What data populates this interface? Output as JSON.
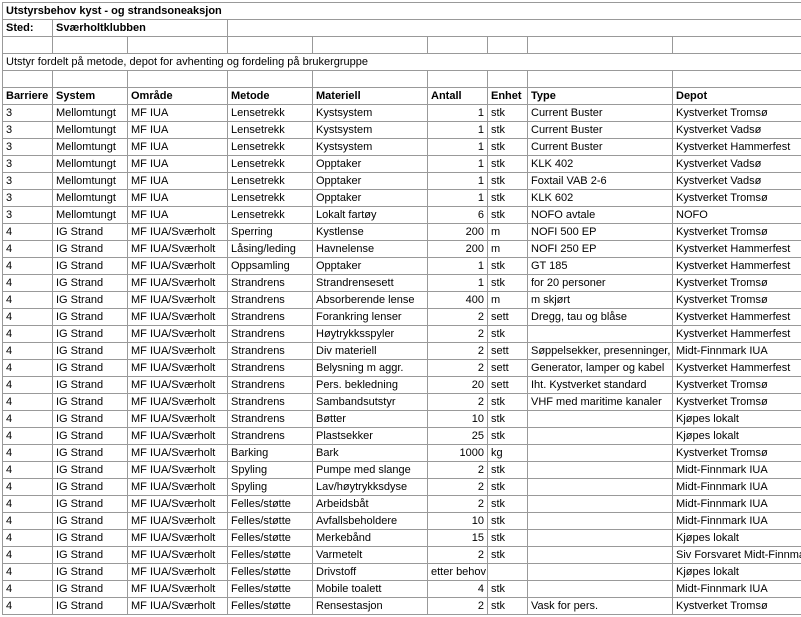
{
  "title": "Utstyrsbehov kyst - og strandsoneaksjon",
  "sted_label": "Sted:",
  "sted_value": "Sværholtklubben",
  "subtitle": "Utstyr fordelt på metode, depot for avhenting og fordeling på brukergruppe",
  "headers": {
    "barriere": "Barriere",
    "system": "System",
    "omrade": "Område",
    "metode": "Metode",
    "materiell": "Materiell",
    "antall": "Antall",
    "enhet": "Enhet",
    "type": "Type",
    "depot": "Depot"
  },
  "rows": [
    {
      "barriere": "3",
      "system": "Mellomtungt",
      "omrade": "MF IUA",
      "metode": "Lensetrekk",
      "materiell": "Kystsystem",
      "antall": "1",
      "enhet": "stk",
      "type": "Current Buster",
      "depot": "Kystverket Tromsø"
    },
    {
      "barriere": "3",
      "system": "Mellomtungt",
      "omrade": "MF IUA",
      "metode": "Lensetrekk",
      "materiell": "Kystsystem",
      "antall": "1",
      "enhet": "stk",
      "type": "Current Buster",
      "depot": "Kystverket Vadsø"
    },
    {
      "barriere": "3",
      "system": "Mellomtungt",
      "omrade": "MF IUA",
      "metode": "Lensetrekk",
      "materiell": "Kystsystem",
      "antall": "1",
      "enhet": "stk",
      "type": "Current Buster",
      "depot": "Kystverket Hammerfest"
    },
    {
      "barriere": "3",
      "system": "Mellomtungt",
      "omrade": "MF IUA",
      "metode": "Lensetrekk",
      "materiell": "Opptaker",
      "antall": "1",
      "enhet": "stk",
      "type": "KLK 402",
      "depot": "Kystverket Vadsø"
    },
    {
      "barriere": "3",
      "system": "Mellomtungt",
      "omrade": "MF IUA",
      "metode": "Lensetrekk",
      "materiell": "Opptaker",
      "antall": "1",
      "enhet": "stk",
      "type": "Foxtail VAB 2-6",
      "depot": "Kystverket Vadsø"
    },
    {
      "barriere": "3",
      "system": "Mellomtungt",
      "omrade": "MF IUA",
      "metode": "Lensetrekk",
      "materiell": "Opptaker",
      "antall": "1",
      "enhet": "stk",
      "type": "KLK 602",
      "depot": "Kystverket Tromsø"
    },
    {
      "barriere": "3",
      "system": "Mellomtungt",
      "omrade": "MF IUA",
      "metode": "Lensetrekk",
      "materiell": "Lokalt fartøy",
      "antall": "6",
      "enhet": "stk",
      "type": "NOFO avtale",
      "depot": "NOFO"
    },
    {
      "barriere": "4",
      "system": "IG Strand",
      "omrade": "MF IUA/Sværholt",
      "metode": "Sperring",
      "materiell": "Kystlense",
      "antall": "200",
      "enhet": "m",
      "type": "NOFI 500 EP",
      "depot": "Kystverket Tromsø"
    },
    {
      "barriere": "4",
      "system": "IG Strand",
      "omrade": "MF IUA/Sværholt",
      "metode": "Låsing/leding",
      "materiell": "Havnelense",
      "antall": "200",
      "enhet": "m",
      "type": "NOFI 250 EP",
      "depot": "Kystverket Hammerfest"
    },
    {
      "barriere": "4",
      "system": "IG Strand",
      "omrade": "MF IUA/Sværholt",
      "metode": "Oppsamling",
      "materiell": "Opptaker",
      "antall": "1",
      "enhet": "stk",
      "type": "GT 185",
      "depot": "Kystverket Hammerfest"
    },
    {
      "barriere": "4",
      "system": "IG Strand",
      "omrade": "MF IUA/Sværholt",
      "metode": "Strandrens",
      "materiell": "Strandrensesett",
      "antall": "1",
      "enhet": "stk",
      "type": "for 20 personer",
      "depot": "Kystverket Tromsø"
    },
    {
      "barriere": "4",
      "system": "IG Strand",
      "omrade": "MF IUA/Sværholt",
      "metode": "Strandrens",
      "materiell": "Absorberende lense",
      "antall": "400",
      "enhet": "m",
      "type": "m skjørt",
      "depot": "Kystverket Tromsø"
    },
    {
      "barriere": "4",
      "system": "IG Strand",
      "omrade": "MF IUA/Sværholt",
      "metode": "Strandrens",
      "materiell": "Forankring lenser",
      "antall": "2",
      "enhet": "sett",
      "type": "Dregg, tau og blåse",
      "depot": "Kystverket Hammerfest"
    },
    {
      "barriere": "4",
      "system": "IG Strand",
      "omrade": "MF IUA/Sværholt",
      "metode": "Strandrens",
      "materiell": "Høytrykksspyler",
      "antall": "2",
      "enhet": "stk",
      "type": "",
      "depot": "Kystverket Hammerfest"
    },
    {
      "barriere": "4",
      "system": "IG Strand",
      "omrade": "MF IUA/Sværholt",
      "metode": "Strandrens",
      "materiell": "Div materiell",
      "antall": "2",
      "enhet": "sett",
      "type": "Søppelsekker, presenninger,",
      "depot": "Midt-Finnmark IUA"
    },
    {
      "barriere": "4",
      "system": "IG Strand",
      "omrade": "MF IUA/Sværholt",
      "metode": "Strandrens",
      "materiell": "Belysning m aggr.",
      "antall": "2",
      "enhet": "sett",
      "type": "Generator, lamper og kabel",
      "depot": "Kystverket Hammerfest"
    },
    {
      "barriere": "4",
      "system": "IG Strand",
      "omrade": "MF IUA/Sværholt",
      "metode": "Strandrens",
      "materiell": "Pers. bekledning",
      "antall": "20",
      "enhet": "sett",
      "type": "Iht. Kystverket standard",
      "depot": "Kystverket Tromsø"
    },
    {
      "barriere": "4",
      "system": "IG Strand",
      "omrade": "MF IUA/Sværholt",
      "metode": "Strandrens",
      "materiell": "Sambandsutstyr",
      "antall": "2",
      "enhet": "stk",
      "type": "VHF med maritime kanaler",
      "depot": "Kystverket Tromsø"
    },
    {
      "barriere": "4",
      "system": "IG Strand",
      "omrade": "MF IUA/Sværholt",
      "metode": "Strandrens",
      "materiell": "Bøtter",
      "antall": "10",
      "enhet": "stk",
      "type": "",
      "depot": "Kjøpes lokalt"
    },
    {
      "barriere": "4",
      "system": "IG Strand",
      "omrade": "MF IUA/Sværholt",
      "metode": "Strandrens",
      "materiell": "Plastsekker",
      "antall": "25",
      "enhet": "stk",
      "type": "",
      "depot": "Kjøpes lokalt"
    },
    {
      "barriere": "4",
      "system": "IG Strand",
      "omrade": "MF IUA/Sværholt",
      "metode": "Barking",
      "materiell": "Bark",
      "antall": "1000",
      "enhet": "kg",
      "type": "",
      "depot": "Kystverket Tromsø"
    },
    {
      "barriere": "4",
      "system": "IG Strand",
      "omrade": "MF IUA/Sværholt",
      "metode": "Spyling",
      "materiell": "Pumpe med slange",
      "antall": "2",
      "enhet": "stk",
      "type": "",
      "depot": "Midt-Finnmark IUA"
    },
    {
      "barriere": "4",
      "system": "IG Strand",
      "omrade": "MF IUA/Sværholt",
      "metode": "Spyling",
      "materiell": "Lav/høytrykksdyse",
      "antall": "2",
      "enhet": "stk",
      "type": "",
      "depot": "Midt-Finnmark IUA"
    },
    {
      "barriere": "4",
      "system": "IG Strand",
      "omrade": "MF IUA/Sværholt",
      "metode": "Felles/støtte",
      "materiell": "Arbeidsbåt",
      "antall": "2",
      "enhet": "stk",
      "type": "",
      "depot": "Midt-Finnmark IUA"
    },
    {
      "barriere": "4",
      "system": "IG Strand",
      "omrade": "MF IUA/Sværholt",
      "metode": "Felles/støtte",
      "materiell": "Avfallsbeholdere",
      "antall": "10",
      "enhet": "stk",
      "type": "",
      "depot": "Midt-Finnmark IUA"
    },
    {
      "barriere": "4",
      "system": "IG Strand",
      "omrade": "MF IUA/Sværholt",
      "metode": "Felles/støtte",
      "materiell": "Merkebånd",
      "antall": "15",
      "enhet": "stk",
      "type": "",
      "depot": "Kjøpes lokalt"
    },
    {
      "barriere": "4",
      "system": "IG Strand",
      "omrade": "MF IUA/Sværholt",
      "metode": "Felles/støtte",
      "materiell": "Varmetelt",
      "antall": "2",
      "enhet": "stk",
      "type": "",
      "depot": "Siv Forsvaret Midt-Finnmark"
    },
    {
      "barriere": "4",
      "system": "IG Strand",
      "omrade": "MF IUA/Sværholt",
      "metode": "Felles/støtte",
      "materiell": "Drivstoff",
      "antall": "etter behov",
      "enhet": "",
      "type": "",
      "depot": "Kjøpes lokalt"
    },
    {
      "barriere": "4",
      "system": "IG Strand",
      "omrade": "MF IUA/Sværholt",
      "metode": "Felles/støtte",
      "materiell": "Mobile toalett",
      "antall": "4",
      "enhet": "stk",
      "type": "",
      "depot": "Midt-Finnmark IUA"
    },
    {
      "barriere": "4",
      "system": "IG Strand",
      "omrade": "MF IUA/Sværholt",
      "metode": "Felles/støtte",
      "materiell": "Rensestasjon",
      "antall": "2",
      "enhet": "stk",
      "type": "Vask for pers.",
      "depot": "Kystverket Tromsø"
    }
  ]
}
